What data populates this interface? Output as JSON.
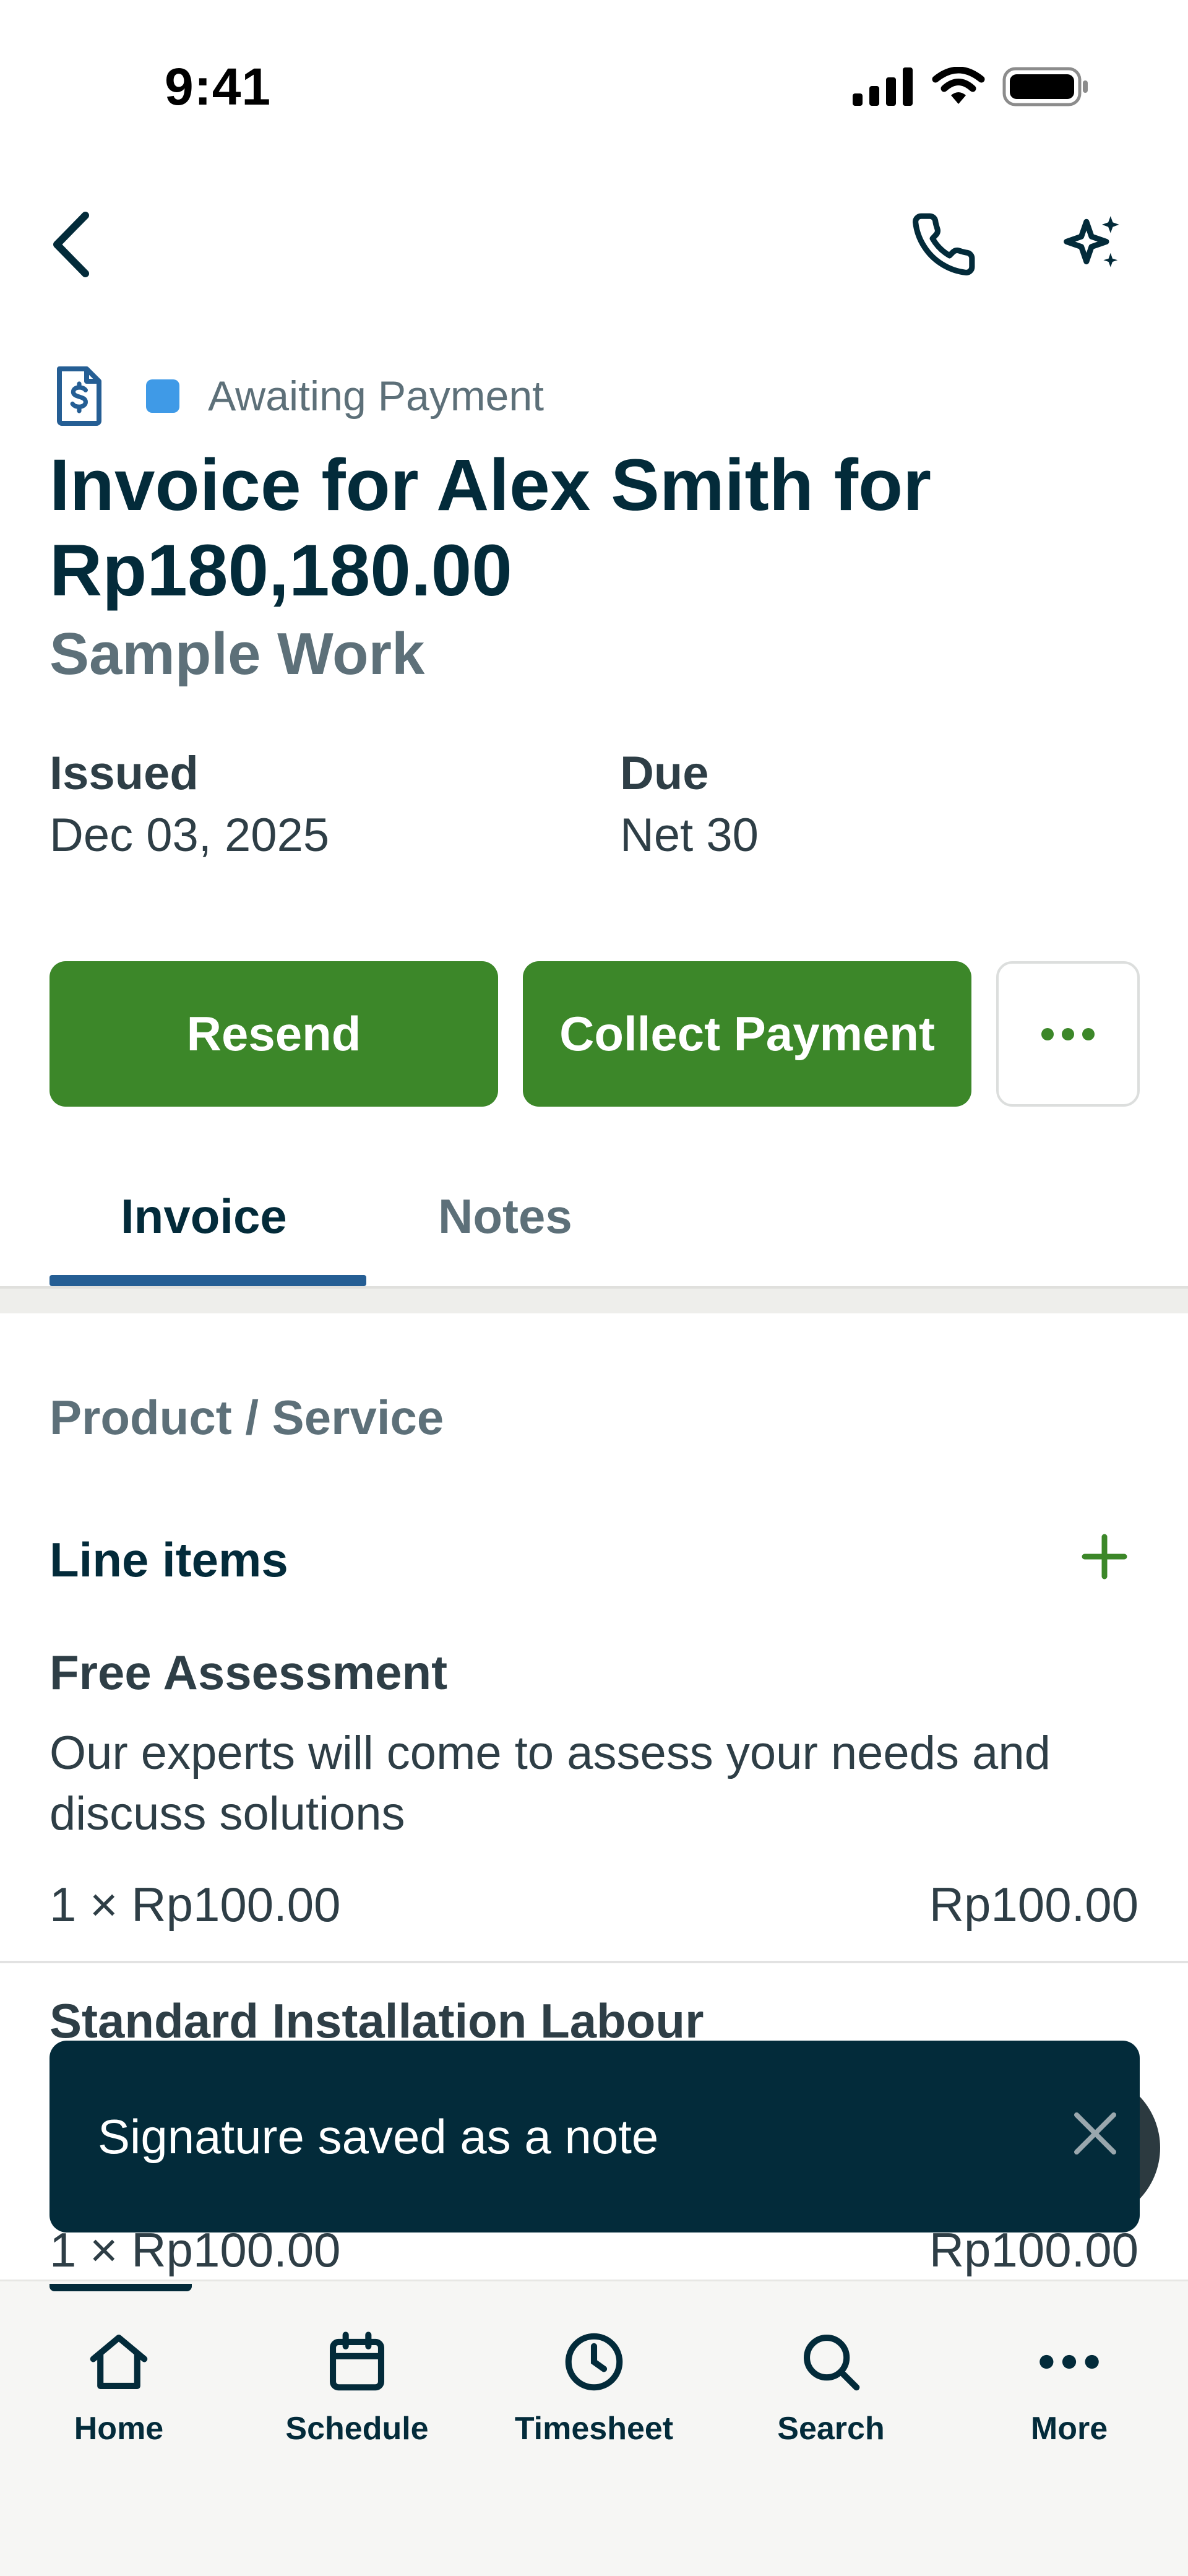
{
  "status_bar": {
    "time": "9:41",
    "icons": [
      "signal-icon",
      "wifi-icon",
      "battery-icon"
    ]
  },
  "nav": {
    "icons": [
      "chevron-left-icon",
      "phone-icon",
      "sparkle-icon"
    ]
  },
  "header": {
    "doc_icon": "invoice-icon",
    "status": "Awaiting Payment",
    "status_color": "#3f9ae7",
    "title": "Invoice for Alex Smith for Rp180,180.00",
    "subtitle": "Sample Work",
    "issued_label": "Issued",
    "issued_value": "Dec 03, 2025",
    "due_label": "Due",
    "due_value": "Net 30"
  },
  "actions": {
    "resend": "Resend",
    "collect_payment": "Collect Payment",
    "more_icon": "more-horizontal-icon",
    "primary_color": "#3c8729"
  },
  "tabs": [
    {
      "label": "Invoice",
      "active": true
    },
    {
      "label": "Notes",
      "active": false
    }
  ],
  "content": {
    "section_title": "Product / Service",
    "line_items_title": "Line items",
    "add_icon": "plus-icon",
    "items": [
      {
        "name": "Free Assessment",
        "description": "Our experts will come to assess your needs and discuss solutions",
        "quantity": "1 × Rp100.00",
        "total": "Rp100.00"
      },
      {
        "name": "Standard Installation Labour",
        "quantity": "1 × Rp100.00",
        "total": "Rp100.00"
      }
    ]
  },
  "toast": {
    "message": "Signature saved as a note",
    "close_icon": "close-icon"
  },
  "bottom_nav": [
    {
      "label": "Home",
      "icon": "home-icon"
    },
    {
      "label": "Schedule",
      "icon": "calendar-icon"
    },
    {
      "label": "Timesheet",
      "icon": "clock-icon"
    },
    {
      "label": "Search",
      "icon": "search-icon"
    },
    {
      "label": "More",
      "icon": "more-horizontal-icon"
    }
  ]
}
